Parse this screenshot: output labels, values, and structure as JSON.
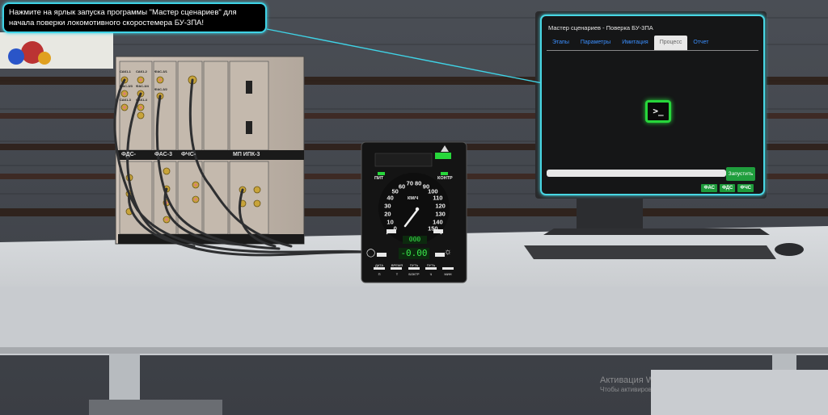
{
  "hint": {
    "text": "Нажмите на ярлык запуска программы \"Мастер сценариев\" для начала поверки локомотивного скоростемера БУ-3ПА!"
  },
  "monitor": {
    "window_title": "Мастер сценариев - Поверка БУ-3ПА",
    "tabs": [
      {
        "label": "Этапы"
      },
      {
        "label": "Параметры"
      },
      {
        "label": "Имитация"
      },
      {
        "label": "Процесс"
      },
      {
        "label": "Отчет"
      }
    ],
    "active_tab": "Процесс",
    "terminal_icon_glyph": ">_",
    "run_button": "Запустить",
    "progress": 0,
    "badges": [
      "ФАС",
      "ФДС",
      "ФЧС"
    ],
    "accent_color": "#48d6e3",
    "green_color": "#27d63b"
  },
  "speedometer": {
    "label_pit": "ПИТ",
    "label_kontr": "КОНТР",
    "unit": "КМ/Ч",
    "scale": [
      "0",
      "10",
      "20",
      "30",
      "40",
      "50",
      "60",
      "70",
      "80",
      "90",
      "100",
      "110",
      "120",
      "130",
      "140",
      "150"
    ],
    "digital_small": "000",
    "digital_main": "-0.00",
    "buttons": [
      {
        "top": "ДАТА",
        "bottom": "П"
      },
      {
        "top": "ВРЕМЯ",
        "bottom": "Т"
      },
      {
        "top": "ПУТЬ",
        "bottom": "БОКТР"
      },
      {
        "top": "ПУТЬ",
        "bottom": "Ч"
      },
      {
        "top": "",
        "bottom": "МИН"
      }
    ]
  },
  "rack": {
    "module_1": "ФДС-",
    "module_2": "ФАС-3",
    "module_3": "ФЧС-",
    "module_4": "МП ИПК-3",
    "small_labels": [
      "САК1-1",
      "САК1-2",
      "ФАС-3/1",
      "ФАС-3/2",
      "ФАС-3/3",
      "ФАС-3/4",
      "САК1-3",
      "САК1-4"
    ]
  },
  "watermark": {
    "line1": "Активация W",
    "line2": "Чтобы активиров"
  }
}
